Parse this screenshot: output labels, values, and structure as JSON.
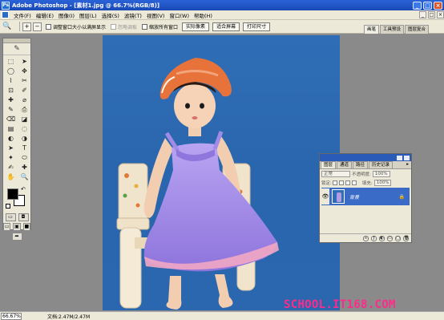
{
  "window": {
    "app_icon": "Ps",
    "title": "Adobe Photoshop - [素材1.jpg @ 66.7%(RGB/8)]",
    "minimize": "_",
    "restore": "□",
    "close": "×"
  },
  "menu": {
    "items": [
      "文件(F)",
      "编辑(E)",
      "图像(I)",
      "图层(L)",
      "选择(S)",
      "滤镜(T)",
      "视图(V)",
      "窗口(W)",
      "帮助(H)"
    ],
    "mdi": [
      "_",
      "□",
      "×"
    ]
  },
  "options": {
    "tool_icon": "🔍",
    "zoom_in": "+",
    "zoom_out": "−",
    "resize_windows": "调整窗口大小以满屏显示",
    "ignore_palettes": "忽略调板",
    "zoom_all": "缩放所有窗口",
    "actual_pixels": "实际像素",
    "fit_screen": "适合屏幕",
    "print_size": "打印尺寸"
  },
  "palette_well": {
    "tabs": [
      "画笔",
      "工具预设",
      "图层复合"
    ]
  },
  "toolbox": {
    "feather": "✎",
    "tools": [
      "⬚",
      "➤",
      "◯",
      "✥",
      "⌇",
      "✂",
      "⊡",
      "✐",
      "✚",
      "⌀",
      "✎",
      "⎙",
      "⌫",
      "◪",
      "▤",
      "◌",
      "◐",
      "◑",
      "➤",
      "T",
      "✦",
      "⬭",
      "✍",
      "✚",
      "✋",
      "🔍"
    ],
    "swap": "↶",
    "modes": [
      "▭",
      "◘"
    ],
    "screens": [
      "▭",
      "▣",
      "■"
    ],
    "jump": [
      "➦"
    ],
    "colors": {
      "foreground": "#000000",
      "background": "#ffffff"
    }
  },
  "status": {
    "zoom": "66.67%",
    "doc": "文档:2.47M/2.47M"
  },
  "layers": {
    "tabs": [
      "图层",
      "通道",
      "路径",
      "历史记录"
    ],
    "tab_arrow": "▸",
    "blend_mode": "正常",
    "opacity_label": "不透明度:",
    "opacity_value": "100%",
    "lock_label": "锁定:",
    "fill_label": "填充:",
    "fill_value": "100%",
    "layer_name": "背景",
    "eye": "👁",
    "lock_icon": "🔒",
    "footer_icons": [
      "∞",
      "ƒ",
      "◐",
      "▭",
      "▢",
      "🗑"
    ]
  },
  "watermark": "SCHOOL.IT168.COM",
  "colors": {
    "backdrop": "#2f6eb6",
    "dress": "#a18be6",
    "hat": "#e8733a",
    "watermark": "#ff2a8a",
    "selected_layer": "#3a6bc6"
  }
}
